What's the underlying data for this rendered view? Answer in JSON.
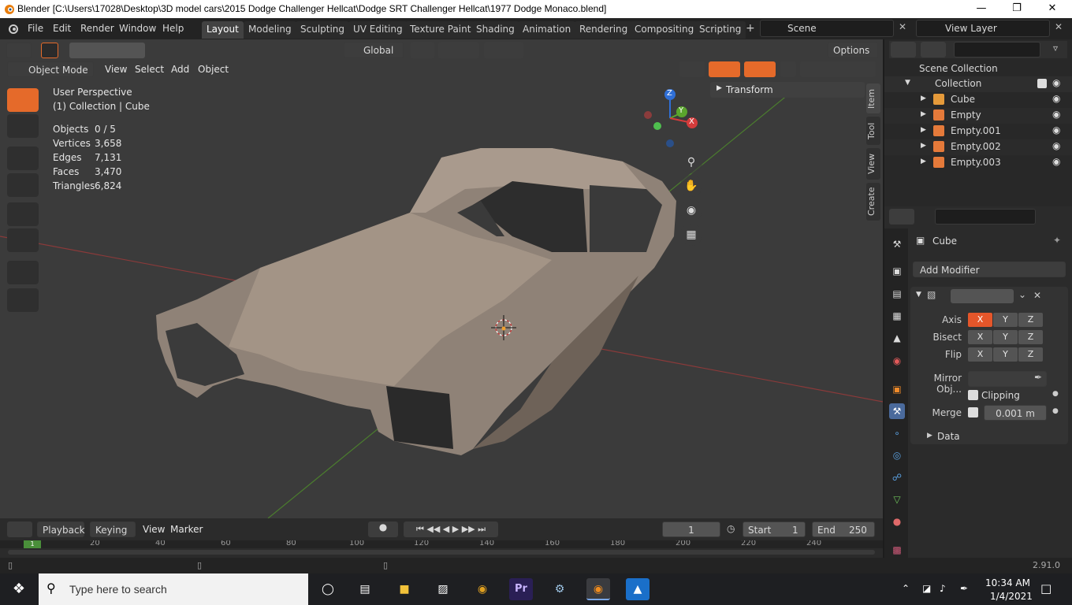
{
  "window": {
    "title": "Blender [C:\\Users\\17028\\Desktop\\3D model cars\\2015 Dodge Challenger Hellcat\\Dodge SRT Challenger Hellcat\\1977 Dodge Monaco.blend]"
  },
  "menu": [
    "File",
    "Edit",
    "Render",
    "Window",
    "Help"
  ],
  "workspaces": [
    "Layout",
    "Modeling",
    "Sculpting",
    "UV Editing",
    "Texture Paint",
    "Shading",
    "Animation",
    "Rendering",
    "Compositing",
    "Scripting"
  ],
  "scene": {
    "name": "Scene",
    "view_layer": "View Layer"
  },
  "header": {
    "orientation": "Global",
    "options": "Options",
    "mode": "Object Mode",
    "view_menu": [
      "View",
      "Select",
      "Add",
      "Object"
    ]
  },
  "viewport": {
    "perspective": "User Perspective",
    "collection": "(1) Collection | Cube",
    "stats": [
      {
        "label": "Objects",
        "value": "0 / 5"
      },
      {
        "label": "Vertices",
        "value": "3,658"
      },
      {
        "label": "Edges",
        "value": "7,131"
      },
      {
        "label": "Faces",
        "value": "3,470"
      },
      {
        "label": "Triangles",
        "value": "6,824"
      }
    ],
    "transform_panel": "Transform",
    "side_tabs": [
      "Item",
      "Tool",
      "View",
      "Create"
    ],
    "gizmo": {
      "x": "X",
      "y": "Y",
      "z": "Z"
    }
  },
  "outliner": {
    "root": "Scene Collection",
    "collection": "Collection",
    "items": [
      "Cube",
      "Empty",
      "Empty.001",
      "Empty.002",
      "Empty.003"
    ]
  },
  "properties": {
    "object": "Cube",
    "add_modifier": "Add Modifier",
    "rows": {
      "axis": "Axis",
      "bisect": "Bisect",
      "flip": "Flip"
    },
    "xyz": [
      "X",
      "Y",
      "Z"
    ],
    "mirror_object": "Mirror Obj...",
    "clipping": "Clipping",
    "merge": "Merge",
    "merge_value": "0.001 m",
    "data": "Data",
    "accent": "#e5562a"
  },
  "timeline": {
    "menus": [
      "Playback",
      "Keying",
      "View",
      "Marker"
    ],
    "current_frame": "1",
    "start_label": "Start",
    "start": "1",
    "end_label": "End",
    "end": "250",
    "ruler": [
      "20",
      "40",
      "60",
      "80",
      "100",
      "120",
      "140",
      "160",
      "180",
      "200",
      "220",
      "240"
    ],
    "ruler_start": "1"
  },
  "status": {
    "version": "2.91.0"
  },
  "taskbar": {
    "search": "Type here to search",
    "time": "10:34 AM",
    "date": "1/4/2021"
  }
}
